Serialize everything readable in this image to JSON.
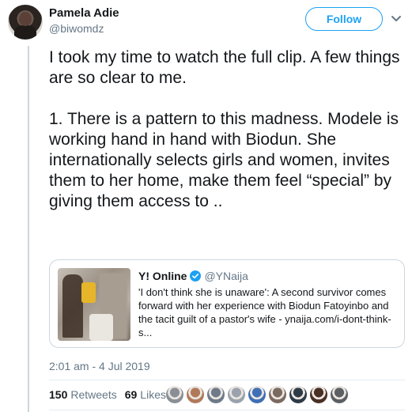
{
  "author": {
    "name": "Pamela Adie",
    "handle": "@biwomdz",
    "avatar_icon": "user-avatar"
  },
  "follow_button": {
    "label": "Follow",
    "color": "#1da1f2"
  },
  "menu_icon": "chevron-down-icon",
  "tweet": {
    "text": "I took my time to watch the full clip. A few things are so clear to me.\n\n1. There is a pattern to this madness. Modele is working hand in hand with Biodun. She internationally selects girls and women, invites them to her home, make them feel “special” by giving them access to .."
  },
  "quoted_card": {
    "name": "Y! Online",
    "verified_icon": "verified-badge-icon",
    "handle": "@YNaija",
    "text": "'I don't think she is unaware': A second survivor comes forward with her experience with Biodun Fatoyinbo and the tacit guilt of a pastor's wife  - ynaija.com/i-dont-think-s..."
  },
  "timestamp": "2:01 am - 4 Jul 2019",
  "stats": {
    "retweets_count": "150",
    "retweets_label": "Retweets",
    "likes_count": "69",
    "likes_label": "Likes"
  },
  "likers": [
    {
      "icon": "liker-avatar",
      "color": "#8a8f96"
    },
    {
      "icon": "liker-avatar",
      "color": "#b07a5a"
    },
    {
      "icon": "liker-avatar",
      "color": "#6d7a88"
    },
    {
      "icon": "liker-avatar",
      "color": "#9aa3ad"
    },
    {
      "icon": "liker-avatar",
      "color": "#3f6fb5"
    },
    {
      "icon": "liker-avatar",
      "color": "#7b6a60"
    },
    {
      "icon": "liker-avatar",
      "color": "#2e3b47"
    },
    {
      "icon": "liker-avatar",
      "color": "#4a2f25"
    },
    {
      "icon": "liker-avatar",
      "color": "#5c5f63"
    }
  ]
}
